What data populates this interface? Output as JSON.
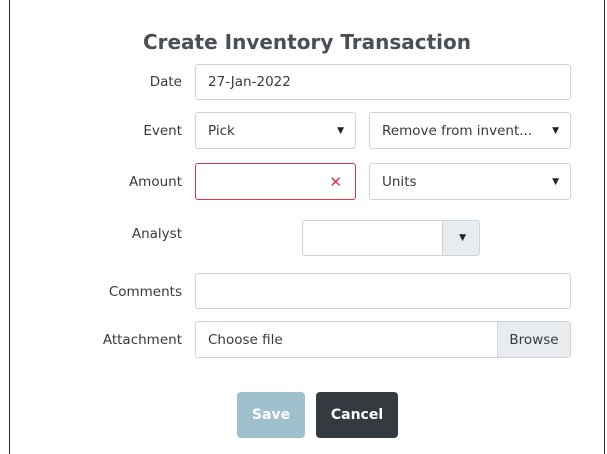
{
  "dialog": {
    "title": "Create Inventory Transaction"
  },
  "form": {
    "date": {
      "label": "Date",
      "value": "27-Jan-2022"
    },
    "event": {
      "label": "Event",
      "type_value": "Pick",
      "action_value": "Remove from invent..."
    },
    "amount": {
      "label": "Amount",
      "value": "",
      "unit_value": "Units",
      "invalid": true
    },
    "analyst": {
      "label": "Analyst",
      "value": ""
    },
    "comments": {
      "label": "Comments",
      "value": ""
    },
    "attachment": {
      "label": "Attachment",
      "placeholder": "Choose file",
      "browse_label": "Browse"
    }
  },
  "actions": {
    "save_label": "Save",
    "cancel_label": "Cancel"
  },
  "colors": {
    "save_button_disabled": "#9fc1cd",
    "cancel_button": "#343a40",
    "invalid_border": "#dc3545",
    "field_border": "#ced4da"
  },
  "icons": {
    "select_caret": "caret-down-icon",
    "invalid_clear": "clear-x-icon"
  }
}
